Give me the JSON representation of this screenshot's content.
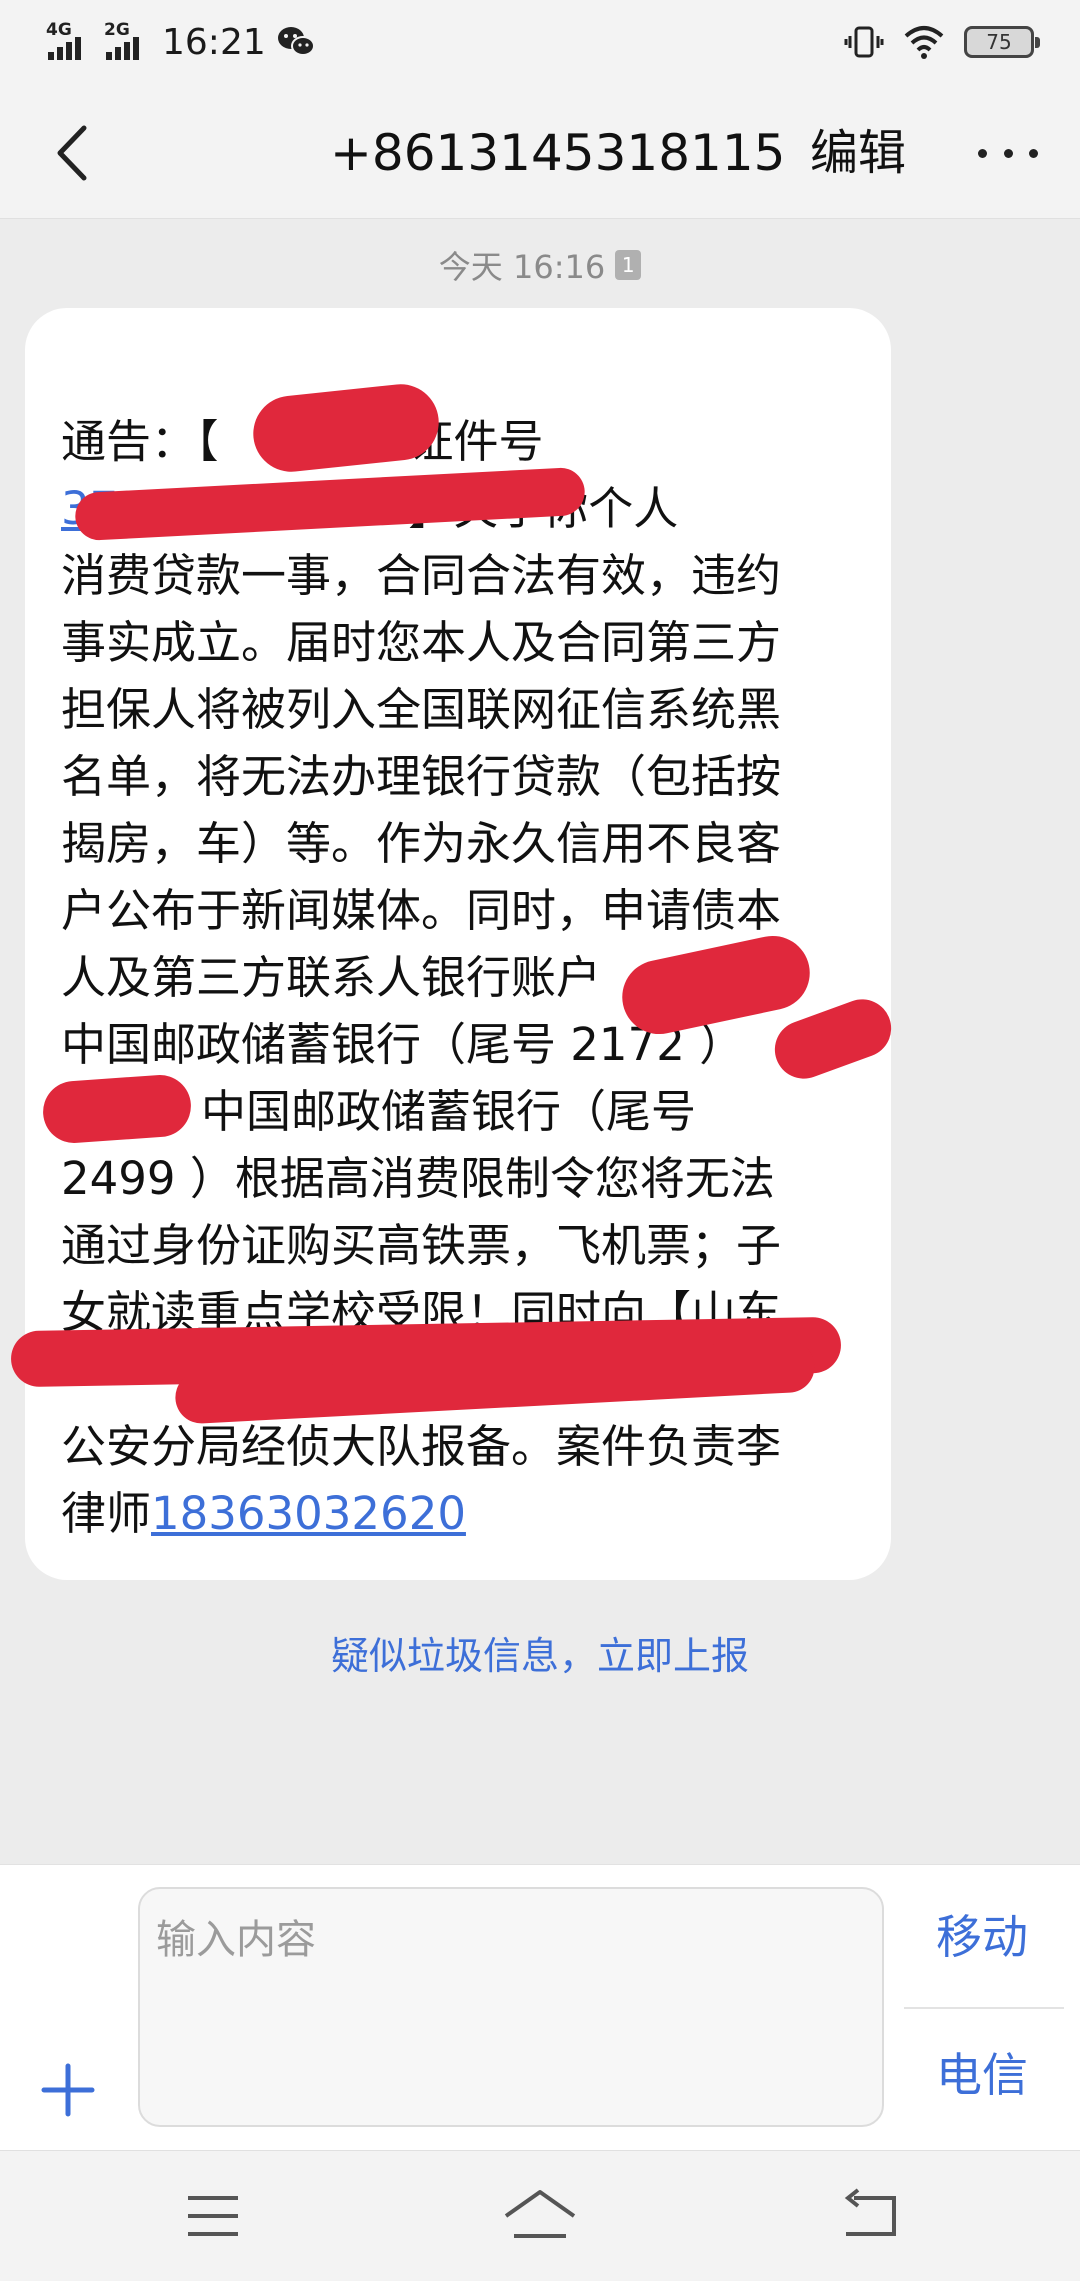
{
  "status_bar": {
    "net_1": "4G",
    "net_2": "2G",
    "time": "16:21",
    "battery": "75",
    "icons": [
      "wechat-icon",
      "vibrate-icon",
      "wifi-icon",
      "battery-icon"
    ]
  },
  "header": {
    "title": "+8613145318115",
    "edit_label": "编辑",
    "icons": [
      "back-icon",
      "more-icon"
    ]
  },
  "conversation": {
    "time_label": "今天 16:16",
    "sim_badge": "1",
    "message": {
      "line_1": "通告：【",
      "line_1b": "证件号",
      "line_2_link": "37",
      "line_2_text": "】关于你个人",
      "line_3": "消费贷款一事，合同合法有效，违约",
      "line_4": "事实成立。届时您本人及合同第三方",
      "line_5": "担保人将被列入全国联网征信系统黑",
      "line_6": "名单，将无法办理银行贷款（包括按",
      "line_7": "揭房，车）等。作为永久信用不良客",
      "line_8": "户公布于新闻媒体。同时，申请债本",
      "line_9": "人及第三方联系人银行账户",
      "line_10": "中国邮政储蓄银行（尾号 2172 ）",
      "line_11": "中国邮政储蓄银行（尾号",
      "line_12": "2499 ）根据高消费限制令您将无法",
      "line_13": "通过身份证购买高铁票，飞机票；子",
      "line_14": "女就读重点学校受限！同时向【山东",
      "line_16": "公安分局经侦大队报备。案件负责李",
      "line_17_text": "律师",
      "line_17_link": "18363032620"
    },
    "report_link": "疑似垃圾信息，立即上报"
  },
  "composer": {
    "placeholder": "输入内容",
    "sim_1": "移动",
    "sim_2": "电信",
    "icons": [
      "plus-icon"
    ]
  },
  "navbar": {
    "icons": [
      "menu-icon",
      "home-icon",
      "back-nav-icon"
    ]
  },
  "colors": {
    "accent": "#3d6fd8",
    "redaction": "#e0283c",
    "background": "#ececec"
  }
}
